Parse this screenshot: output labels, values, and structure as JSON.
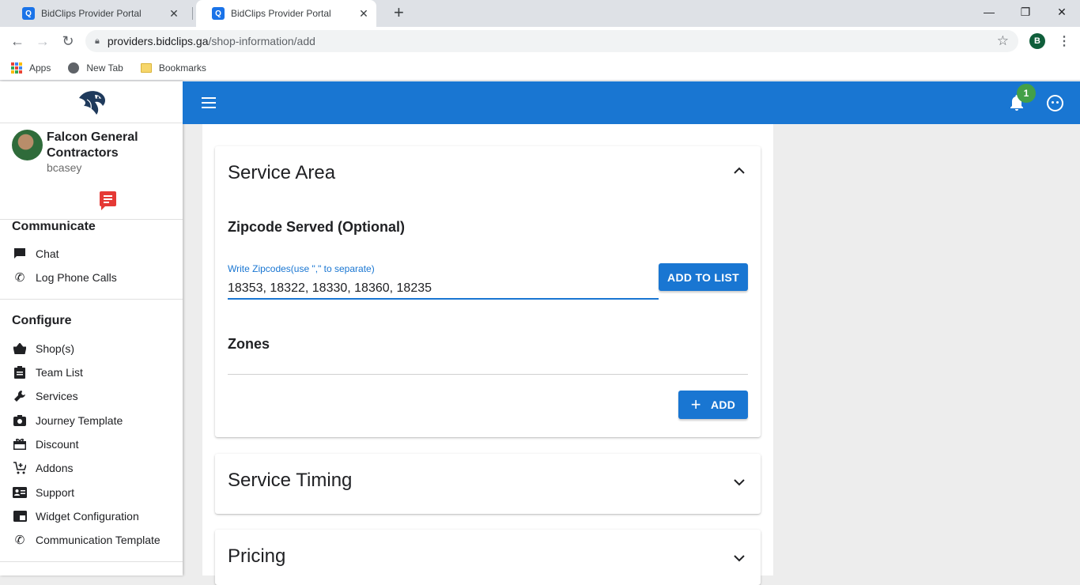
{
  "browser": {
    "tabs": [
      {
        "title": "BidClips Provider Portal",
        "favicon": "Q",
        "active": false
      },
      {
        "title": "BidClips Provider Portal",
        "favicon": "Q",
        "active": true
      }
    ],
    "url_host": "providers.bidclips.ga",
    "url_path": "/shop-information/add",
    "profile_initial": "B",
    "bookmarks": [
      {
        "label": "Apps",
        "icon": "apps-grid-icon"
      },
      {
        "label": "New Tab",
        "icon": "globe-icon"
      },
      {
        "label": "Bookmarks",
        "icon": "folder-icon"
      }
    ]
  },
  "sidebar": {
    "company": "Falcon General Contractors",
    "username": "bcasey",
    "sections": [
      {
        "title": "Communicate",
        "items": [
          {
            "label": "Chat",
            "icon": "chat-icon"
          },
          {
            "label": "Log Phone Calls",
            "icon": "phone-log-icon"
          }
        ]
      },
      {
        "title": "Configure",
        "items": [
          {
            "label": "Shop(s)",
            "icon": "basket-icon"
          },
          {
            "label": "Team List",
            "icon": "clipboard-icon"
          },
          {
            "label": "Services",
            "icon": "wrench-icon"
          },
          {
            "label": "Journey Template",
            "icon": "camera-icon"
          },
          {
            "label": "Discount",
            "icon": "gift-icon"
          },
          {
            "label": "Addons",
            "icon": "cart-plus-icon"
          },
          {
            "label": "Support",
            "icon": "contact-card-icon"
          },
          {
            "label": "Widget Configuration",
            "icon": "widget-icon"
          },
          {
            "label": "Communication Template",
            "icon": "phone-settings-icon"
          }
        ]
      }
    ]
  },
  "appbar": {
    "notification_count": "1",
    "colors": {
      "primary": "#1976d2",
      "badge": "#43a047",
      "chat_alert": "#e53935"
    }
  },
  "service_area": {
    "title": "Service Area",
    "zipcode_heading": "Zipcode Served (Optional)",
    "zipcode_label": "Write Zipcodes(use \",\" to separate)",
    "zipcode_value": "18353, 18322, 18330, 18360, 18235",
    "add_to_list_label": "ADD TO LIST",
    "zones_heading": "Zones",
    "add_label": "ADD"
  },
  "service_timing": {
    "title": "Service Timing"
  },
  "pricing": {
    "title": "Pricing"
  }
}
